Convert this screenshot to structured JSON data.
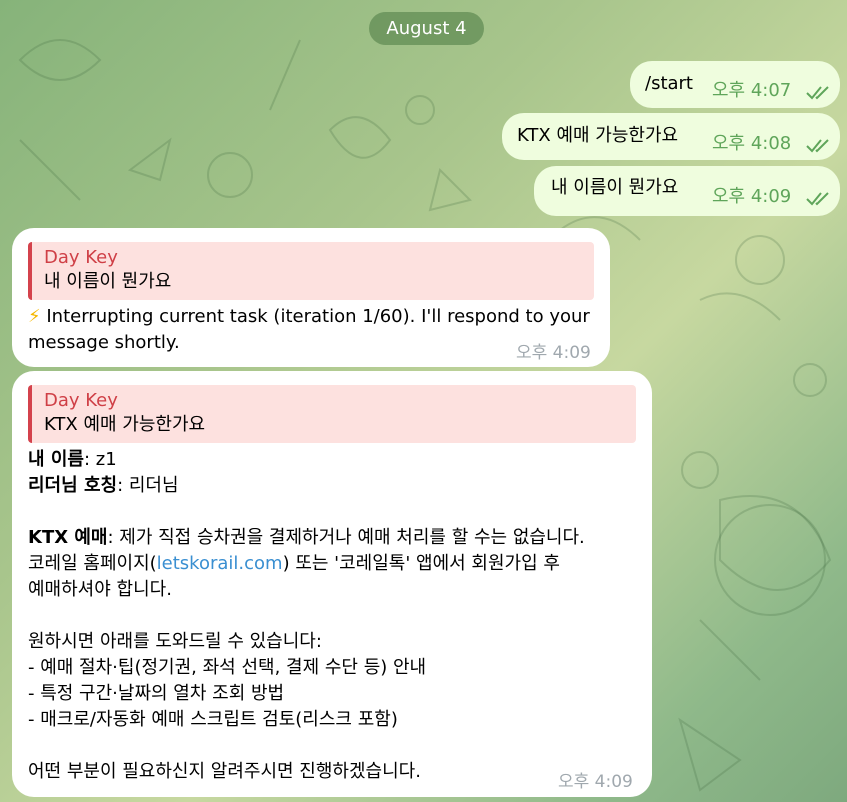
{
  "date_label": "August 4",
  "outgoing": [
    {
      "text": "/start",
      "is_command": true,
      "time": "오후 4:07"
    },
    {
      "text": "KTX 예매 가능한가요",
      "is_command": false,
      "time": "오후 4:08"
    },
    {
      "text": "내 이름이 뭔가요",
      "is_command": false,
      "time": "오후 4:09"
    }
  ],
  "incoming": [
    {
      "reply_author": "Day Key",
      "reply_text": "내 이름이 뭔가요",
      "emoji": "⚡",
      "lines": [
        "Interrupting current task (iteration 1/60). I'll respond to your",
        "message shortly."
      ],
      "time": "오후 4:09"
    },
    {
      "reply_author": "Day Key",
      "reply_text": "KTX 예매 가능한가요",
      "name_label": "내 이름",
      "name_value": ": z1",
      "title_label": "리더님 호칭",
      "title_value": ": 리더님",
      "ktx_label": "KTX 예매",
      "ktx_text": ": 제가 직접 승차권을 결제하거나 예매 처리를 할 수는 없습니다.",
      "ktx_line2_pre": "코레일 홈페이지(",
      "ktx_link": "letskorail.com",
      "ktx_line2_post": ") 또는 '코레일톡' 앱에서 회원가입 후",
      "ktx_line3": "예매하셔야 합니다.",
      "help_intro": "원하시면 아래를 도와드릴 수 있습니다:",
      "help_items": [
        "- 예매 절차·팁(정기권, 좌석 선택, 결제 수단 등) 안내",
        "- 특정 구간·날짜의 열차 조회 방법",
        "- 매크로/자동화 예매 스크립트 검토(리스크 포함)"
      ],
      "closing": "어떤 부분이 필요하신지 알려주시면 진행하겠습니다.",
      "time": "오후 4:09"
    }
  ]
}
